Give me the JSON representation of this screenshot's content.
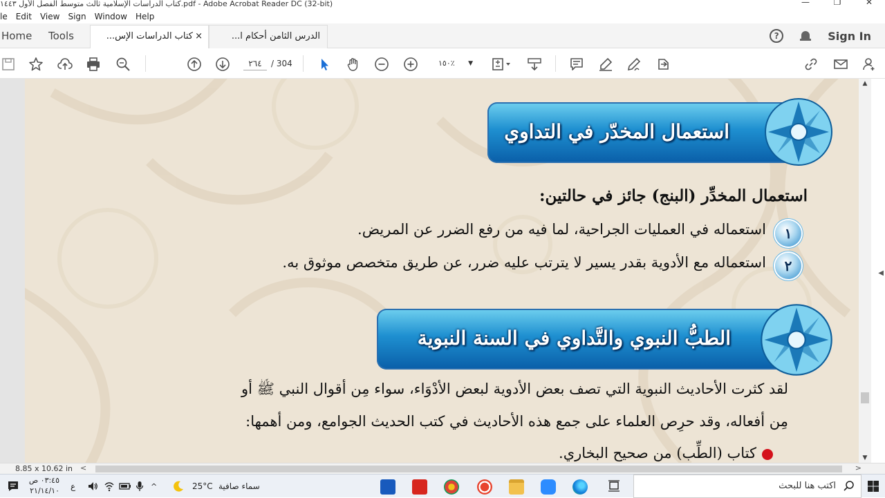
{
  "window": {
    "title": "كتاب الدراسات الإسلامية ثالث متوسط الفصل الأول ١٤٤٣.pdf - Adobe Acrobat Reader DC (32-bit)",
    "controls": [
      "—",
      "❐",
      "✕"
    ]
  },
  "menu": {
    "items": [
      "le",
      "Edit",
      "View",
      "Sign",
      "Window",
      "Help"
    ]
  },
  "tabs": {
    "home": "Home",
    "tools": "Tools",
    "documents": [
      {
        "label": "كتاب الدراسات الإس...",
        "close": "×",
        "active": true
      },
      {
        "label": "الدرس الثامن أحكام ا...",
        "active": false
      }
    ],
    "sign_in": "Sign In",
    "help_glyph": "?"
  },
  "toolbar": {
    "current_page": "٢٦٤",
    "page_total": "/  304",
    "zoom": "١٥٠٪"
  },
  "page": {
    "banner1": "استعمال المخدّر في التداوي",
    "heading": "استعمال المخدِّر (البنج) جائز في حالتين:",
    "items": [
      {
        "num": "١",
        "text": "استعماله في العمليات الجراحية، لما فيه من رفع الضرر عن المريض."
      },
      {
        "num": "٢",
        "text": "استعماله مع الأدوية بقدر يسير لا يترتب عليه ضرر، عن طريق متخصص موثوق به."
      }
    ],
    "banner2": "الطبُّ النبوي والتَّداوي في السنة النبوية",
    "para_line1": "لقد كثرت الأحاديث النبوية التي تصف بعض الأدوية لبعض الأدْوَاء، سواء مِن أقوال النبي ﷺ أو",
    "para_line2": "مِن أفعاله، وقد حرِص العلماء على جمع هذه الأحاديث في كتب الحديث الجوامع، ومن أهمها:",
    "bullet1": "كتاب (الطِّب) من صحيح البخاري."
  },
  "status": {
    "page_size": "8.85 x 10.62 in"
  },
  "taskbar": {
    "search_placeholder": "اكتب هنا للبحث",
    "weather_text": "سماء صافية",
    "temperature": "25°C",
    "lang": "ع",
    "time": "٠٣:٤٥ ص",
    "date": "٢١/١٤/١٠"
  },
  "colors": {
    "banner_blue": "#1e8fd0",
    "page_beige": "#ede4d5",
    "bullet_red": "#d4111b"
  }
}
